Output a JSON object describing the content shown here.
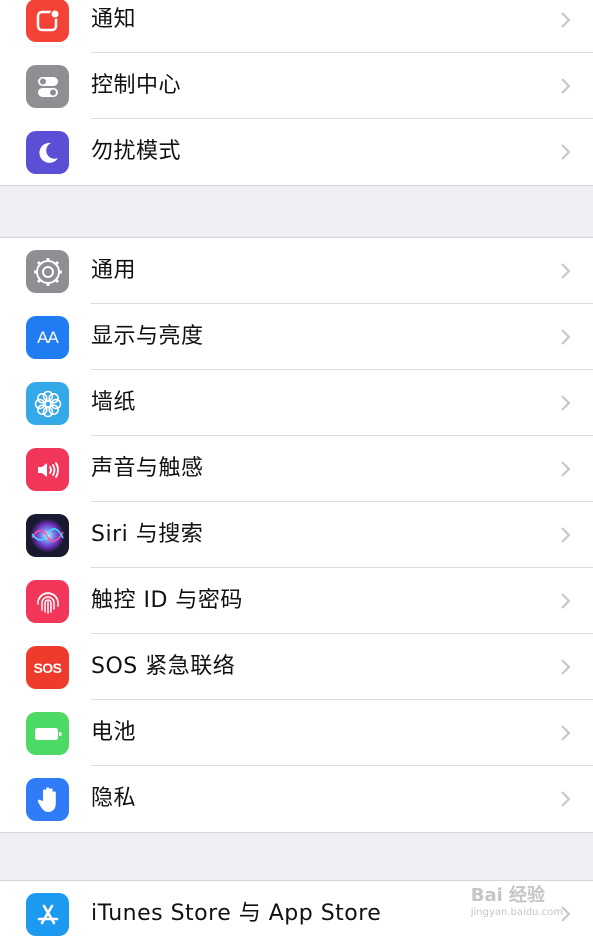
{
  "colors": {
    "notifications": "#f44336",
    "control_center": "#8e8e93",
    "do_not_disturb": "#5b4fd6",
    "general": "#8e8e93",
    "display": "#1f7cf2",
    "wallpaper": "#35a9e8",
    "sounds": "#f2365a",
    "siri": "#1a1a2e",
    "touch_id": "#f2365a",
    "sos": "#ef3b2c",
    "battery": "#4cd964",
    "privacy": "#2f7cf6",
    "app_store": "#1c9af0"
  },
  "groups": [
    {
      "items": [
        {
          "label": "通知",
          "icon": "notifications-icon"
        },
        {
          "label": "控制中心",
          "icon": "control-center-icon"
        },
        {
          "label": "勿扰模式",
          "icon": "moon-icon"
        }
      ]
    },
    {
      "items": [
        {
          "label": "通用",
          "icon": "gear-icon"
        },
        {
          "label": "显示与亮度",
          "icon": "display-brightness-icon"
        },
        {
          "label": "墙纸",
          "icon": "wallpaper-flower-icon"
        },
        {
          "label": "声音与触感",
          "icon": "speaker-icon"
        },
        {
          "label": "Siri 与搜索",
          "icon": "siri-icon"
        },
        {
          "label": "触控 ID 与密码",
          "icon": "fingerprint-icon"
        },
        {
          "label": "SOS 紧急联络",
          "icon": "sos-icon"
        },
        {
          "label": "电池",
          "icon": "battery-icon"
        },
        {
          "label": "隐私",
          "icon": "hand-icon"
        }
      ]
    },
    {
      "items": [
        {
          "label": "iTunes Store 与 App Store",
          "icon": "app-store-icon"
        }
      ]
    }
  ],
  "icon_text": {
    "display": "AA",
    "sos": "SOS"
  },
  "watermark": {
    "brand": "Bai 经验",
    "url": "jingyan.baidu.com"
  }
}
